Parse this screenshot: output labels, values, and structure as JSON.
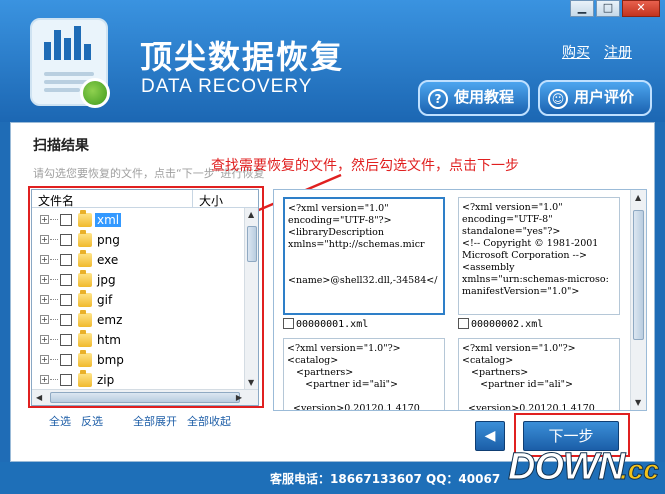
{
  "window": {
    "minimize": "▁",
    "restore": "□",
    "close": "✕"
  },
  "header": {
    "title": "顶尖数据恢复",
    "subtitle": "DATA RECOVERY",
    "link_buy": "购买",
    "link_register": "注册",
    "btn_tutorial": "使用教程",
    "btn_tutorial_icon": "question-circle-icon",
    "btn_review": "用户评价",
    "btn_review_icon": "user-icon"
  },
  "panel": {
    "section_title": "扫描结果",
    "hint": "请勾选您要恢复的文件，点击“下一步”进行恢复",
    "annotation": "查找需要恢复的文件，然后勾选文件，点击下一步",
    "annotation_color": "#e02020"
  },
  "tree": {
    "col_name": "文件名",
    "col_size": "大小",
    "items": [
      {
        "label": "xml",
        "selected": true
      },
      {
        "label": "png"
      },
      {
        "label": "exe"
      },
      {
        "label": "jpg"
      },
      {
        "label": "gif"
      },
      {
        "label": "emz"
      },
      {
        "label": "htm"
      },
      {
        "label": "bmp"
      },
      {
        "label": "zip"
      }
    ],
    "select_all": "全选",
    "invert": "反选",
    "expand_all": "全部展开",
    "collapse_all": "全部收起"
  },
  "preview": {
    "cards": [
      {
        "content": "<?xml version=\"1.0\"\nencoding=\"UTF-8\"?>\n<libraryDescription\nxmlns=\"http://schemas.micr\n\n\n<name>@shell32.dll,-34584</",
        "label": "00000001.xml"
      },
      {
        "content": "<?xml version=\"1.0\"\nencoding=\"UTF-8\"\nstandalone=\"yes\"?>\n<!-- Copyright © 1981-2001\nMicrosoft Corporation -->\n<assembly\nxmlns=\"urn:schemas-microso:\nmanifestVersion=\"1.0\">",
        "label": "00000002.xml"
      },
      {
        "content": "<?xml version=\"1.0\"?>\n<catalog>\n   <partners>\n      <partner id=\"ali\">\n\n  <version>0.20120.1 4170",
        "label": ""
      },
      {
        "content": "<?xml version=\"1.0\"?>\n<catalog>\n   <partners>\n      <partner id=\"ali\">\n\n  <version>0.20120.1 4170",
        "label": ""
      }
    ]
  },
  "nav": {
    "back": "◀",
    "next": "下一步"
  },
  "footer": {
    "text": "客服电话：18667133607 QQ：40067"
  },
  "watermark": {
    "main": "DOWN",
    "suffix": ".cc"
  }
}
